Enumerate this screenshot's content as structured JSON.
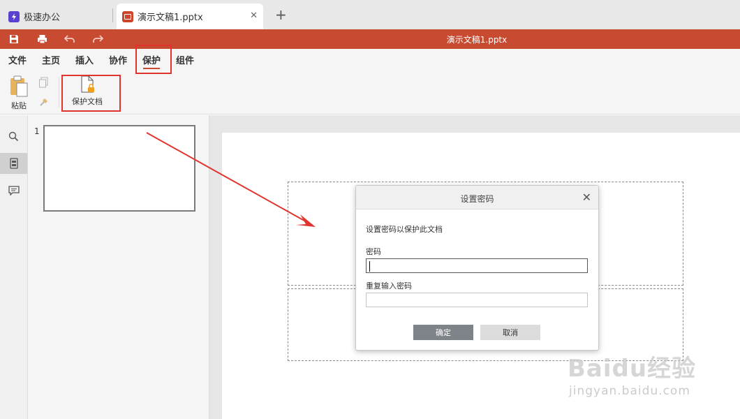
{
  "tabs": [
    {
      "label": "极速办公",
      "icon": "app-logo-icon"
    },
    {
      "label": "演示文稿1.pptx",
      "icon": "presentation-file-icon",
      "close_glyph": "✕"
    }
  ],
  "new_tab_glyph": "+",
  "titlebar": {
    "doc_title": "演示文稿1.pptx",
    "accent_color": "#c84b31",
    "quick_actions": [
      "save-icon",
      "print-icon",
      "undo-icon",
      "redo-icon"
    ]
  },
  "menu": {
    "items": [
      "文件",
      "主页",
      "插入",
      "协作",
      "保护",
      "组件"
    ],
    "active": "保护"
  },
  "ribbon": {
    "paste_label": "粘贴",
    "protect_doc_label": "保护文档"
  },
  "sidebar": {
    "icons": [
      "search-icon",
      "slides-icon",
      "comment-icon"
    ],
    "active": "slides-icon"
  },
  "thumbnails": [
    {
      "number": "1"
    }
  ],
  "dialog": {
    "title": "设置密码",
    "close_glyph": "✕",
    "description": "设置密码以保护此文档",
    "password_label": "密码",
    "password_value": "",
    "repeat_label": "重复输入密码",
    "repeat_value": "",
    "ok_label": "确定",
    "cancel_label": "取消"
  },
  "watermark": {
    "logo_text": "Baidu经验",
    "url": "jingyan.baidu.com"
  }
}
